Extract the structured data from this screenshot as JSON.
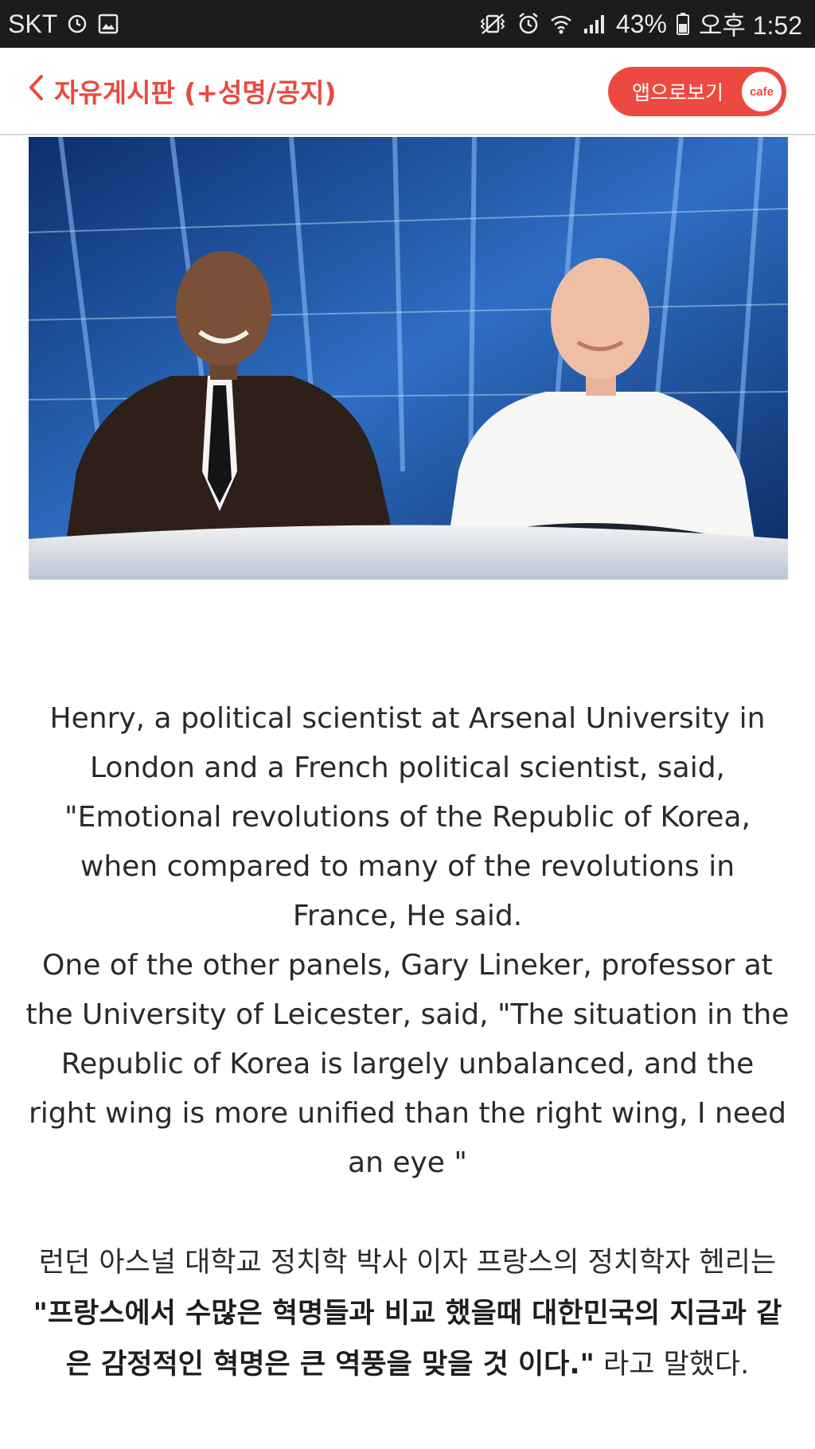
{
  "status_bar": {
    "carrier": "SKT",
    "battery": "43%",
    "time": "오후 1:52",
    "icons": [
      "alarm-icon",
      "image-icon",
      "vibrate-icon",
      "alarm-clock-icon",
      "wifi-icon",
      "signal-icon",
      "battery-icon"
    ]
  },
  "header": {
    "back_label": "자유게시판 (+성명/공지)",
    "app_button_label": "앱으로보기",
    "cafe_badge": "cafe"
  },
  "colors": {
    "accent": "#ec4a40",
    "status_bar_bg": "#1c1c1e",
    "text": "#2a2a2a"
  },
  "article": {
    "english_paragraphs": [
      "Henry, a political scientist at Arsenal University in London and a French political scientist, said, \"Emotional revolutions of the Republic of Korea, when compared to many of the revolutions in France, He said.",
      "One of the other panels, Gary Lineker, professor at the University of Leicester, said, \"The situation in the Republic of Korea is largely unbalanced, and the right wing is more unified than the right wing, I need an eye \""
    ],
    "korean": {
      "lead": "런던 아스널 대학교 정치학 박사 이자 프랑스의 정치학자 헨리는 ",
      "quote": "\"프랑스에서 수많은 혁명들과 비교 했을때 대한민국의 지금과 같은 감정적인 혁명은 큰 역풍을 맞을 것 이다.\"",
      "tail": " 라고 말했다."
    }
  }
}
